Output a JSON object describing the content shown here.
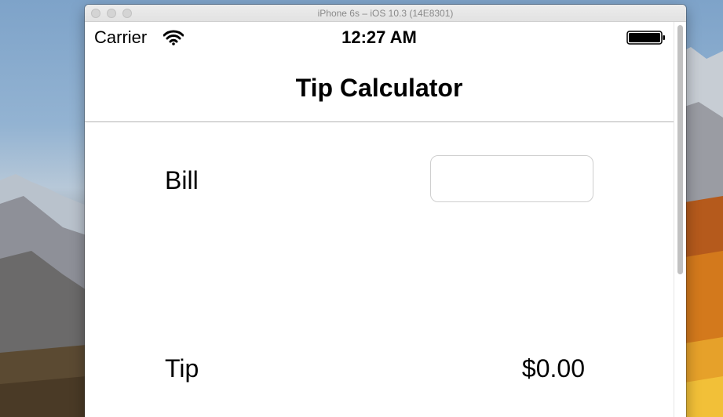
{
  "window": {
    "title": "iPhone 6s – iOS 10.3 (14E8301)"
  },
  "status_bar": {
    "carrier": "Carrier",
    "time": "12:27 AM",
    "wifi_icon": "wifi-icon",
    "battery_icon": "battery-icon",
    "battery_level": 1.0
  },
  "nav": {
    "title": "Tip Calculator"
  },
  "form": {
    "bill_label": "Bill",
    "bill_value": "",
    "tip_label": "Tip",
    "tip_value": "$0.00"
  },
  "colors": {
    "divider": "#b2b2b2",
    "input_border": "#cfcfcf",
    "text": "#000000"
  }
}
